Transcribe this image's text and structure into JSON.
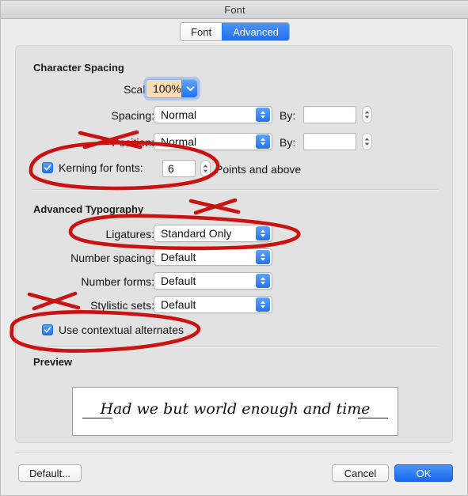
{
  "window": {
    "title": "Font"
  },
  "tabs": [
    {
      "label": "Font",
      "selected": false
    },
    {
      "label": "Advanced",
      "selected": true
    }
  ],
  "character_spacing": {
    "section_title": "Character Spacing",
    "scale": {
      "label": "Scale:",
      "value": "100%",
      "focused": true
    },
    "spacing": {
      "label": "Spacing:",
      "value": "Normal",
      "by_label": "By:",
      "by_value": ""
    },
    "position": {
      "label": "Position:",
      "value": "Normal",
      "by_label": "By:",
      "by_value": ""
    },
    "kerning": {
      "checkbox_label": "Kerning for fonts:",
      "checked": true,
      "value": "6",
      "suffix_label": "Points and above"
    }
  },
  "advanced_typography": {
    "section_title": "Advanced Typography",
    "rows": [
      {
        "label": "Ligatures:",
        "value": "Standard Only"
      },
      {
        "label": "Number spacing:",
        "value": "Default"
      },
      {
        "label": "Number forms:",
        "value": "Default"
      },
      {
        "label": "Stylistic sets:",
        "value": "Default"
      }
    ],
    "contextual_alternates": {
      "label": "Use contextual alternates",
      "checked": true
    }
  },
  "preview": {
    "section_title": "Preview",
    "sample_text": "Had we but world enough and time"
  },
  "footer": {
    "default_label": "Default...",
    "cancel_label": "Cancel",
    "ok_label": "OK"
  },
  "colors": {
    "accent_blue": "#2274f2",
    "tab_selected_blue": "#3478f6",
    "focus_field_fill": "#fbdcb4",
    "annotation_red": "#cc1111",
    "dialog_bg": "#ececec",
    "panel_bg": "#e2e2e2"
  },
  "icons": {
    "popup_arrows": "updown-chevron-icon",
    "dropdown_chevron": "chevron-down-icon",
    "stepper": "stepper-arrows-icon",
    "checkmark": "checkmark-icon"
  }
}
